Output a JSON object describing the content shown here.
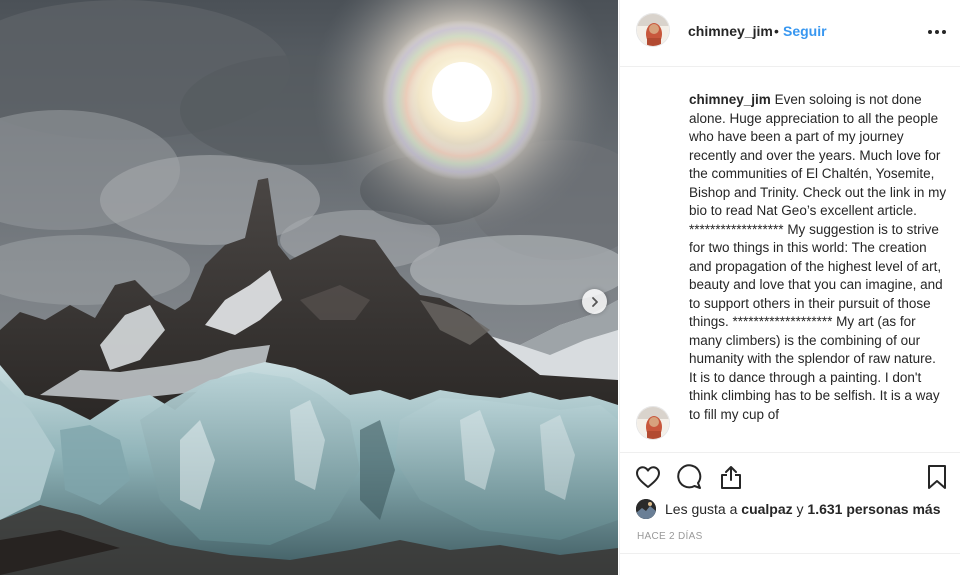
{
  "post": {
    "username": "chimney_jim",
    "separator": "•",
    "follow_label": "Seguir",
    "caption": "Even soloing is not done alone. Huge appreciation to all the people who have been a part of my journey recently and over the years. Much love for the communities of El Chaltén, Yosemite, Bishop and Trinity. Check out the link in my bio to read Nat Geo’s excellent article. ****************** My suggestion is to strive for two things in this world: The creation and propagation of the highest level of art, beauty and love that you can imagine, and to support others in their pursuit of those things. ******************* My art (as for many climbers) is the combining of our humanity with the splendor of raw nature. It is to dance through a painting. I don't think climbing has to be selfish. It is a way to fill my cup of",
    "likes": {
      "prefix": "Les gusta a ",
      "user": "cualpaz",
      "middle": " y ",
      "count": "1.631 personas más"
    },
    "time": "HACE 2 DÍAS"
  },
  "icons": {
    "more": "more-options-icon",
    "like": "heart-icon",
    "comment": "comment-icon",
    "share": "share-icon",
    "save": "bookmark-icon",
    "next": "chevron-right-icon"
  },
  "colors": {
    "link_blue": "#3897f0",
    "text": "#262626",
    "muted": "#999999",
    "border": "#efefef"
  }
}
